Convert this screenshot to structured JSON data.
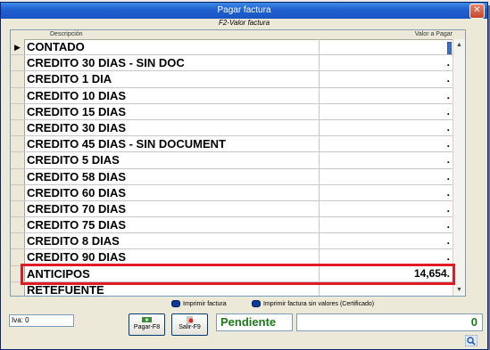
{
  "window": {
    "title": "Pagar factura",
    "close_icon": "close-icon"
  },
  "hint": "F2-Valor factura",
  "grid": {
    "columns": [
      "Descripción",
      "Valor a Pagar"
    ],
    "rows": [
      {
        "desc": "CONTADO",
        "value": ""
      },
      {
        "desc": "CREDITO 30 DIAS - SIN DOC",
        "value": "."
      },
      {
        "desc": "CREDITO 1 DIA",
        "value": "."
      },
      {
        "desc": "CREDITO 10 DIAS",
        "value": "."
      },
      {
        "desc": "CREDITO 15 DIAS",
        "value": "."
      },
      {
        "desc": "CREDITO 30 DIAS",
        "value": "."
      },
      {
        "desc": "CREDITO 45 DIAS - SIN DOCUMENT",
        "value": "."
      },
      {
        "desc": "CREDITO 5 DIAS",
        "value": "."
      },
      {
        "desc": "CREDITO 58 DIAS",
        "value": "."
      },
      {
        "desc": "CREDITO 60 DIAS",
        "value": "."
      },
      {
        "desc": "CREDITO 70 DIAS",
        "value": "."
      },
      {
        "desc": "CREDITO 75 DIAS",
        "value": "."
      },
      {
        "desc": "CREDITO 8 DIAS",
        "value": "."
      },
      {
        "desc": "CREDITO 90 DIAS",
        "value": "."
      },
      {
        "desc": "ANTICIPOS",
        "value": "14,654."
      },
      {
        "desc": "RETEFUENTE",
        "value": ""
      }
    ],
    "selected_row": 0
  },
  "options": {
    "print_invoice": "Imprimir factura",
    "print_without_values": "Imprimir factura sin valores (Certificado)"
  },
  "iva": {
    "label": "Iva: 0"
  },
  "buttons": {
    "pay": "Pagar-F8",
    "exit": "Salir-F9"
  },
  "status": "Pendiente",
  "total": "0",
  "colors": {
    "title_bar": "#1f5fcf",
    "status_text": "#1a7a1a",
    "highlight": "#e01b24"
  }
}
